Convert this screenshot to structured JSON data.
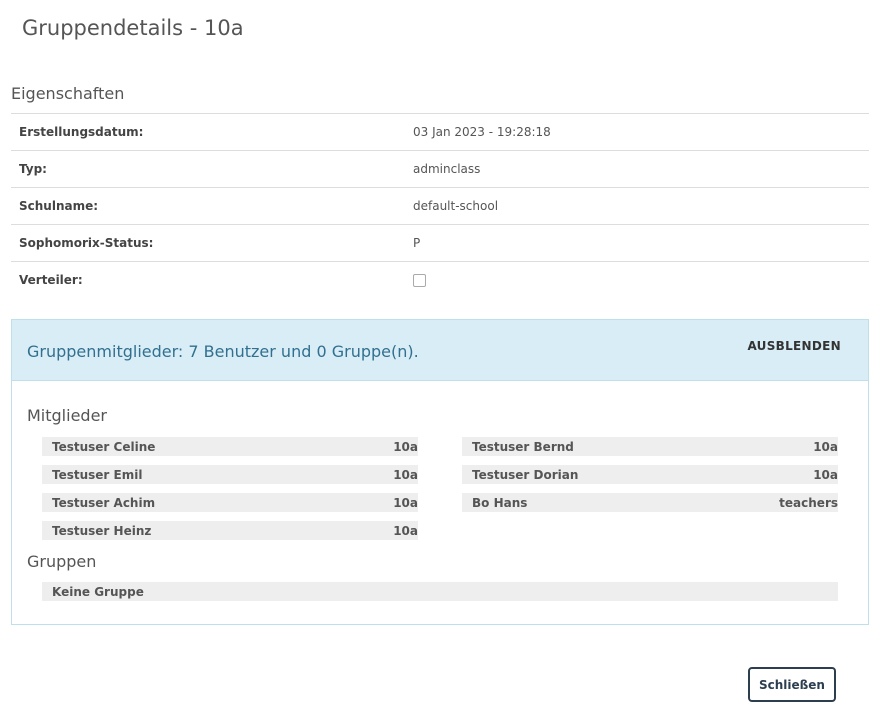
{
  "dialog": {
    "title": "Gruppendetails - 10a",
    "close_label": "Schließen"
  },
  "properties": {
    "section_title": "Eigenschaften",
    "rows": [
      {
        "label": "Erstellungsdatum:",
        "value": "03 Jan 2023 - 19:28:18"
      },
      {
        "label": "Typ:",
        "value": "adminclass"
      },
      {
        "label": "Schulname:",
        "value": "default-school"
      },
      {
        "label": "Sophomorix-Status:",
        "value": "P"
      },
      {
        "label": "Verteiler:",
        "checked": false
      }
    ]
  },
  "members_panel": {
    "heading": "Gruppenmitglieder: 7 Benutzer und 0 Gruppe(n).",
    "toggle_label": "AUSBLENDEN",
    "members_title": "Mitglieder",
    "members": [
      {
        "name": "Testuser Celine",
        "group": "10a"
      },
      {
        "name": "Testuser Bernd",
        "group": "10a"
      },
      {
        "name": "Testuser Emil",
        "group": "10a"
      },
      {
        "name": "Testuser Dorian",
        "group": "10a"
      },
      {
        "name": "Testuser Achim",
        "group": "10a"
      },
      {
        "name": "Bo Hans",
        "group": "teachers"
      },
      {
        "name": "Testuser Heinz",
        "group": "10a"
      }
    ],
    "groups_title": "Gruppen",
    "groups_empty": "Keine Gruppe"
  }
}
